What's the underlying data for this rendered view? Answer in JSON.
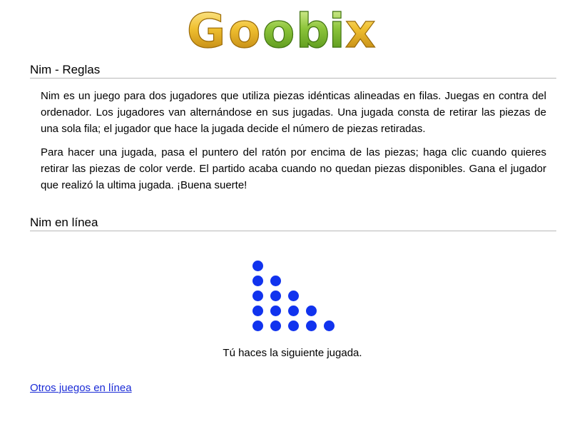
{
  "logo": {
    "text": "Goobix",
    "letters": [
      {
        "char": "G",
        "color": "#e0a418"
      },
      {
        "char": "o",
        "color": "#e0a418"
      },
      {
        "char": "o",
        "color": "#7cbc2e"
      },
      {
        "char": "b",
        "color": "#7cbc2e"
      },
      {
        "char": "i",
        "color": "#7cbc2e"
      },
      {
        "char": "x",
        "color": "#e0a418"
      }
    ]
  },
  "rules": {
    "title": "Nim - Reglas",
    "paragraph1": "Nim es un juego para dos jugadores que utiliza piezas idénticas alineadas en filas. Juegas en contra del ordenador. Los jugadores van alternándose en sus jugadas. Una jugada consta de retirar las piezas de una sola fila; el jugador que hace la jugada decide el número de piezas retiradas.",
    "paragraph2": "Para hacer una jugada, pasa el puntero del ratón por encima de las piezas; haga clic cuando quieres retirar las piezas de color verde. El partido acaba cuando no quedan piezas disponibles. Gana el jugador que realizó la ultima jugada. ¡Buena suerte!"
  },
  "game": {
    "title": "Nim en línea",
    "rows": [
      5,
      4,
      3,
      2,
      1
    ],
    "piece_color": "#1133ee",
    "status": "Tú haces la siguiente jugada."
  },
  "footer": {
    "other_games_link": "Otros juegos en línea"
  }
}
